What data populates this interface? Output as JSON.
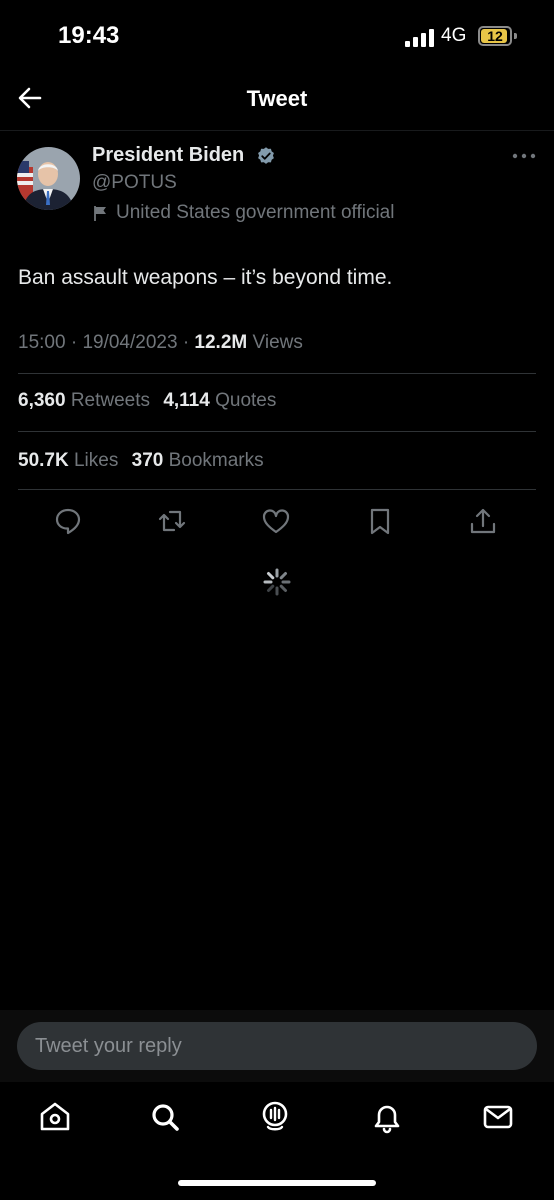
{
  "status_bar": {
    "time": "19:43",
    "network": "4G",
    "battery_level": "12",
    "battery_color": "#e8c547"
  },
  "header": {
    "title": "Tweet",
    "back_icon": "arrow-left-icon"
  },
  "tweet": {
    "author_name": "President Biden",
    "handle": "@POTUS",
    "account_label": "United States government official",
    "text": "Ban assault weapons – it’s beyond time.",
    "time": "15:00",
    "date": "19/04/2023",
    "views_count": "12.2M",
    "views_label": "Views",
    "retweets_count": "6,360",
    "retweets_label": "Retweets",
    "quotes_count": "4,114",
    "quotes_label": "Quotes",
    "likes_count": "50.7K",
    "likes_label": "Likes",
    "bookmarks_count": "370",
    "bookmarks_label": "Bookmarks"
  },
  "actions": [
    "reply-icon",
    "retweet-icon",
    "like-icon",
    "bookmark-icon",
    "share-icon"
  ],
  "reply": {
    "placeholder": "Tweet your reply"
  },
  "tab_bar": [
    "home-icon",
    "search-icon",
    "spaces-icon",
    "notifications-icon",
    "messages-icon"
  ],
  "colors": {
    "background": "#000000",
    "text_primary": "#e7e9ea",
    "text_secondary": "#71767b",
    "verified_badge": "#829aab"
  }
}
